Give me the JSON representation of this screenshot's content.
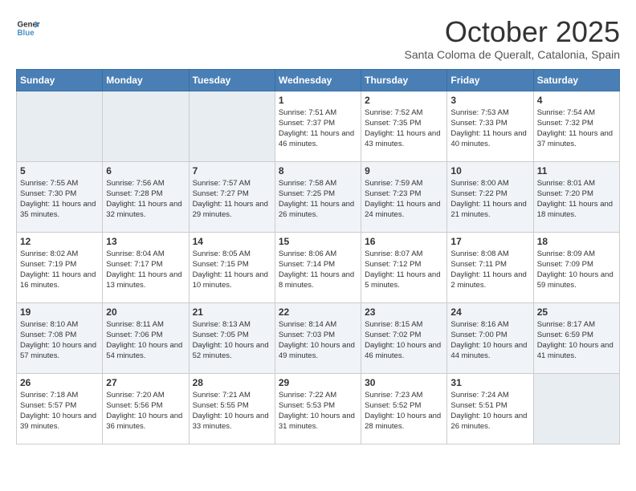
{
  "header": {
    "logo_line1": "General",
    "logo_line2": "Blue",
    "month": "October 2025",
    "location": "Santa Coloma de Queralt, Catalonia, Spain"
  },
  "weekdays": [
    "Sunday",
    "Monday",
    "Tuesday",
    "Wednesday",
    "Thursday",
    "Friday",
    "Saturday"
  ],
  "weeks": [
    [
      {
        "day": "",
        "empty": true
      },
      {
        "day": "",
        "empty": true
      },
      {
        "day": "",
        "empty": true
      },
      {
        "day": "1",
        "sunrise": "7:51 AM",
        "sunset": "7:37 PM",
        "daylight": "11 hours and 46 minutes."
      },
      {
        "day": "2",
        "sunrise": "7:52 AM",
        "sunset": "7:35 PM",
        "daylight": "11 hours and 43 minutes."
      },
      {
        "day": "3",
        "sunrise": "7:53 AM",
        "sunset": "7:33 PM",
        "daylight": "11 hours and 40 minutes."
      },
      {
        "day": "4",
        "sunrise": "7:54 AM",
        "sunset": "7:32 PM",
        "daylight": "11 hours and 37 minutes."
      }
    ],
    [
      {
        "day": "5",
        "sunrise": "7:55 AM",
        "sunset": "7:30 PM",
        "daylight": "11 hours and 35 minutes."
      },
      {
        "day": "6",
        "sunrise": "7:56 AM",
        "sunset": "7:28 PM",
        "daylight": "11 hours and 32 minutes."
      },
      {
        "day": "7",
        "sunrise": "7:57 AM",
        "sunset": "7:27 PM",
        "daylight": "11 hours and 29 minutes."
      },
      {
        "day": "8",
        "sunrise": "7:58 AM",
        "sunset": "7:25 PM",
        "daylight": "11 hours and 26 minutes."
      },
      {
        "day": "9",
        "sunrise": "7:59 AM",
        "sunset": "7:23 PM",
        "daylight": "11 hours and 24 minutes."
      },
      {
        "day": "10",
        "sunrise": "8:00 AM",
        "sunset": "7:22 PM",
        "daylight": "11 hours and 21 minutes."
      },
      {
        "day": "11",
        "sunrise": "8:01 AM",
        "sunset": "7:20 PM",
        "daylight": "11 hours and 18 minutes."
      }
    ],
    [
      {
        "day": "12",
        "sunrise": "8:02 AM",
        "sunset": "7:19 PM",
        "daylight": "11 hours and 16 minutes."
      },
      {
        "day": "13",
        "sunrise": "8:04 AM",
        "sunset": "7:17 PM",
        "daylight": "11 hours and 13 minutes."
      },
      {
        "day": "14",
        "sunrise": "8:05 AM",
        "sunset": "7:15 PM",
        "daylight": "11 hours and 10 minutes."
      },
      {
        "day": "15",
        "sunrise": "8:06 AM",
        "sunset": "7:14 PM",
        "daylight": "11 hours and 8 minutes."
      },
      {
        "day": "16",
        "sunrise": "8:07 AM",
        "sunset": "7:12 PM",
        "daylight": "11 hours and 5 minutes."
      },
      {
        "day": "17",
        "sunrise": "8:08 AM",
        "sunset": "7:11 PM",
        "daylight": "11 hours and 2 minutes."
      },
      {
        "day": "18",
        "sunrise": "8:09 AM",
        "sunset": "7:09 PM",
        "daylight": "10 hours and 59 minutes."
      }
    ],
    [
      {
        "day": "19",
        "sunrise": "8:10 AM",
        "sunset": "7:08 PM",
        "daylight": "10 hours and 57 minutes."
      },
      {
        "day": "20",
        "sunrise": "8:11 AM",
        "sunset": "7:06 PM",
        "daylight": "10 hours and 54 minutes."
      },
      {
        "day": "21",
        "sunrise": "8:13 AM",
        "sunset": "7:05 PM",
        "daylight": "10 hours and 52 minutes."
      },
      {
        "day": "22",
        "sunrise": "8:14 AM",
        "sunset": "7:03 PM",
        "daylight": "10 hours and 49 minutes."
      },
      {
        "day": "23",
        "sunrise": "8:15 AM",
        "sunset": "7:02 PM",
        "daylight": "10 hours and 46 minutes."
      },
      {
        "day": "24",
        "sunrise": "8:16 AM",
        "sunset": "7:00 PM",
        "daylight": "10 hours and 44 minutes."
      },
      {
        "day": "25",
        "sunrise": "8:17 AM",
        "sunset": "6:59 PM",
        "daylight": "10 hours and 41 minutes."
      }
    ],
    [
      {
        "day": "26",
        "sunrise": "7:18 AM",
        "sunset": "5:57 PM",
        "daylight": "10 hours and 39 minutes."
      },
      {
        "day": "27",
        "sunrise": "7:20 AM",
        "sunset": "5:56 PM",
        "daylight": "10 hours and 36 minutes."
      },
      {
        "day": "28",
        "sunrise": "7:21 AM",
        "sunset": "5:55 PM",
        "daylight": "10 hours and 33 minutes."
      },
      {
        "day": "29",
        "sunrise": "7:22 AM",
        "sunset": "5:53 PM",
        "daylight": "10 hours and 31 minutes."
      },
      {
        "day": "30",
        "sunrise": "7:23 AM",
        "sunset": "5:52 PM",
        "daylight": "10 hours and 28 minutes."
      },
      {
        "day": "31",
        "sunrise": "7:24 AM",
        "sunset": "5:51 PM",
        "daylight": "10 hours and 26 minutes."
      },
      {
        "day": "",
        "empty": true
      }
    ]
  ]
}
